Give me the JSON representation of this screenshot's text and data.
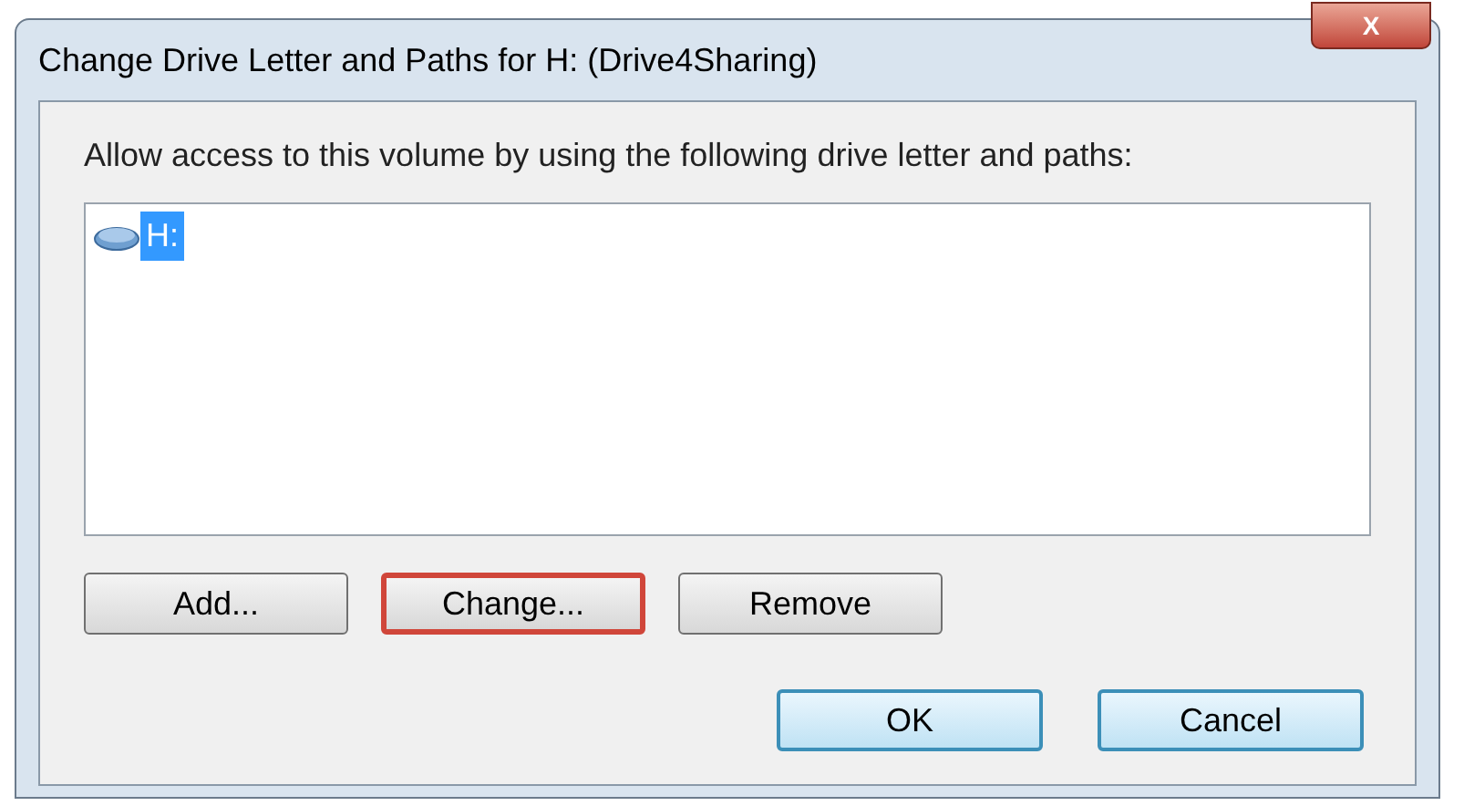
{
  "window": {
    "title": "Change Drive Letter and Paths for H: (Drive4Sharing)",
    "close": "X"
  },
  "prompt": "Allow access to this volume by using the following drive letter and paths:",
  "paths": [
    {
      "label": "H:",
      "selected": true
    }
  ],
  "buttons": [
    {
      "label": "Add...",
      "focused": false
    },
    {
      "label": "Change...",
      "focused": true
    },
    {
      "label": "Remove",
      "focused": false
    }
  ],
  "dialog_buttons": [
    {
      "label": "OK"
    },
    {
      "label": "Cancel"
    }
  ]
}
